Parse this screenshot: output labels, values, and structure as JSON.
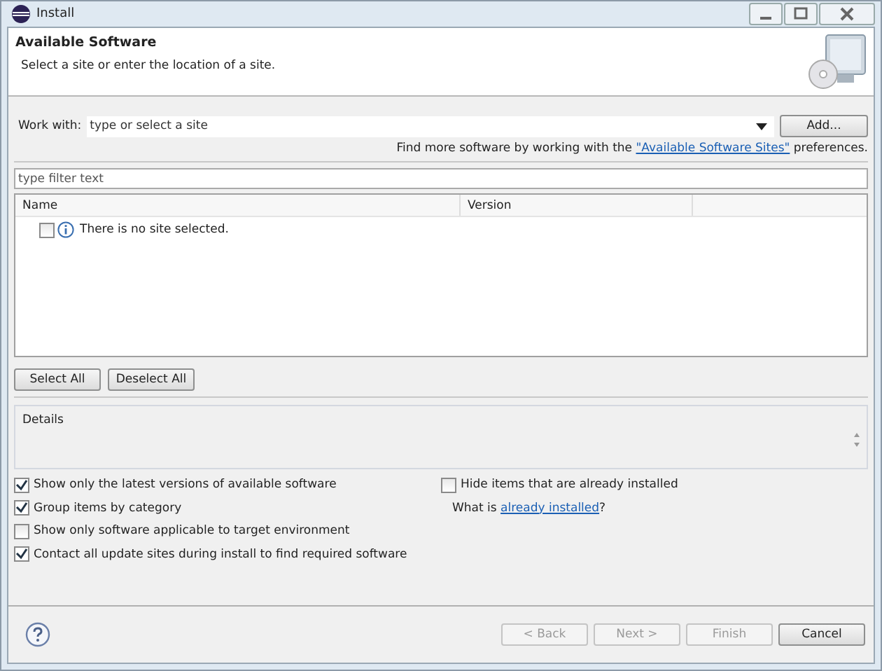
{
  "window": {
    "title": "Install"
  },
  "header": {
    "title": "Available Software",
    "subtitle": "Select a site or enter the location of a site."
  },
  "work_with": {
    "label": "Work with:",
    "placeholder": "type or select a site",
    "add_button": "Add..."
  },
  "find_more": {
    "before": "Find more software by working with the",
    "link": "\"Available Software Sites\"",
    "after": "preferences."
  },
  "filter": {
    "placeholder": "type filter text"
  },
  "table": {
    "columns": [
      "Name",
      "Version"
    ],
    "rows": [
      {
        "text": "There is no site selected.",
        "checked": false
      }
    ]
  },
  "selection_buttons": [
    "Select All",
    "Deselect All"
  ],
  "details": {
    "label": "Details"
  },
  "options_left": [
    {
      "label": "Show only the latest versions of available software",
      "checked": true
    },
    {
      "label": "Group items by category",
      "checked": true
    },
    {
      "label": "Show only software applicable to target environment",
      "checked": false
    },
    {
      "label": "Contact all update sites during install to find required software",
      "checked": true
    }
  ],
  "options_right": {
    "hide_installed": {
      "label": "Hide items that are already installed",
      "checked": false
    },
    "what_is": "What is",
    "link": "already installed",
    "after": "?"
  },
  "footer_buttons": [
    {
      "label": "< Back",
      "disabled": true
    },
    {
      "label": "Next >",
      "disabled": true
    },
    {
      "label": "Finish",
      "disabled": true
    },
    {
      "label": "Cancel",
      "disabled": false
    }
  ]
}
